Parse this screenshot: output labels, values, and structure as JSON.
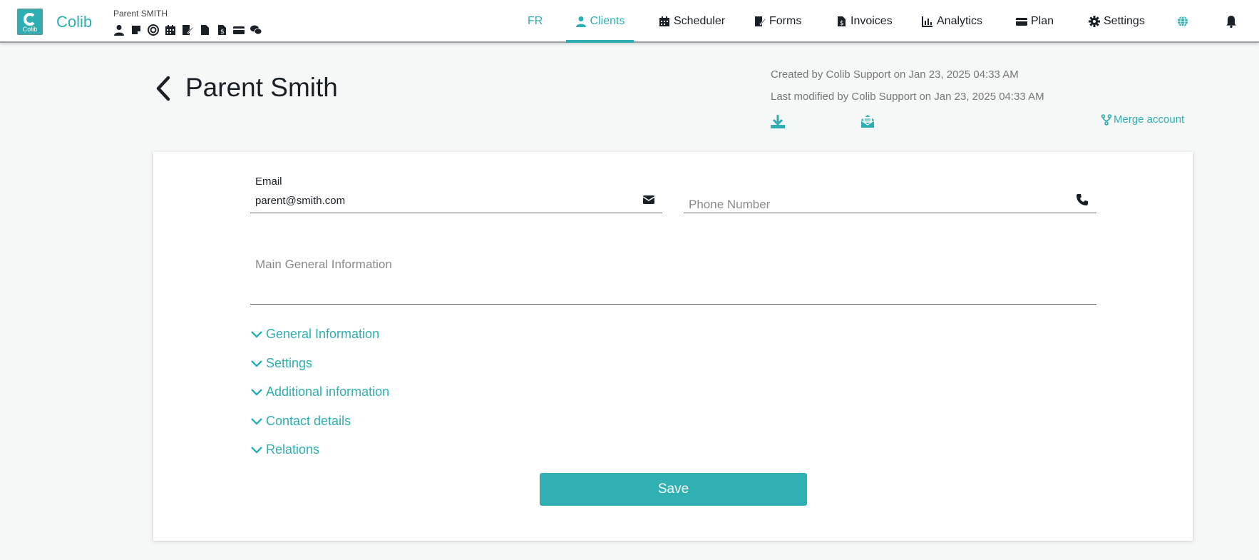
{
  "app": {
    "logo_text": "Colib",
    "brand": "Colib",
    "user_name": "Parent SMITH",
    "quick_icons": [
      "user-icon",
      "note-icon",
      "target-icon",
      "calendar-icon",
      "signature-icon",
      "file-icon",
      "invoice-icon",
      "credit-card-icon",
      "chat-icon"
    ]
  },
  "nav": {
    "lang": "FR",
    "clients": "Clients",
    "scheduler": "Scheduler",
    "forms": "Forms",
    "invoices": "Invoices",
    "analytics": "Analytics",
    "plan": "Plan",
    "settings": "Settings",
    "active": "Clients"
  },
  "header": {
    "title": "Parent Smith",
    "created": "Created by Colib Support on Jan 23, 2025 04:33 AM",
    "modified": "Last modified by Colib Support on Jan 23, 2025 04:33 AM",
    "merge_label": "Merge account"
  },
  "form": {
    "email_label": "Email",
    "email_value": "parent@smith.com",
    "phone_placeholder": "Phone Number",
    "main_info_placeholder": "Main General Information",
    "sections": [
      "General Information",
      "Settings",
      "Additional information",
      "Contact details",
      "Relations"
    ],
    "save_label": "Save"
  },
  "colors": {
    "accent": "#2faeb1",
    "highlight": "#e0151f"
  }
}
